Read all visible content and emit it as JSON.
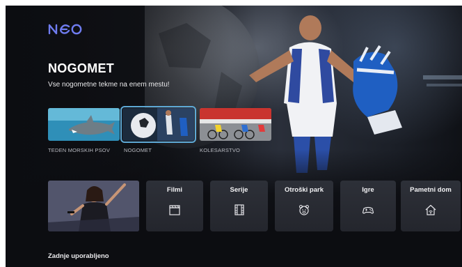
{
  "app": {
    "logo_text": "neo"
  },
  "hero": {
    "title": "NOGOMET",
    "subtitle": "Vse nogometne tekme na enem mestu!"
  },
  "channels": [
    {
      "label": "TEDEN MORSKIH PSOV",
      "icon": "shark-thumbnail",
      "selected": false
    },
    {
      "label": "NOGOMET",
      "icon": "football-thumbnail",
      "selected": true
    },
    {
      "label": "KOLESARSTVO",
      "icon": "cycling-thumbnail",
      "selected": false
    }
  ],
  "categories": [
    {
      "label": "Filmi",
      "icon": "clapperboard-icon"
    },
    {
      "label": "Serije",
      "icon": "film-strip-icon"
    },
    {
      "label": "Otroški park",
      "icon": "bear-icon"
    },
    {
      "label": "Igre",
      "icon": "gamepad-icon"
    },
    {
      "label": "Pametni dom",
      "icon": "smart-home-icon"
    }
  ],
  "recent": {
    "title": "Zadnje uporabljeno"
  },
  "colors": {
    "accent": "#5ea9d6",
    "logo": "#6f7cf0",
    "background": "#0c0d11"
  }
}
